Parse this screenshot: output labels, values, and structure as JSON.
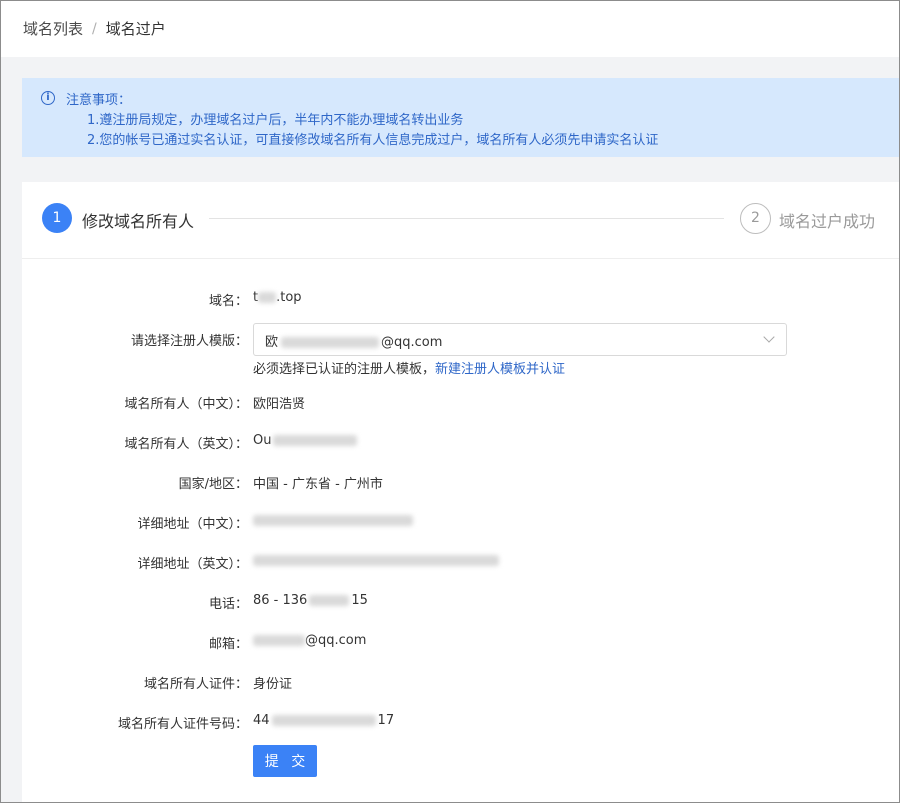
{
  "breadcrumb": {
    "item1": "域名列表",
    "separator": "/",
    "item2": "域名过户"
  },
  "notice": {
    "icon": "info-icon",
    "title": "注意事项：",
    "line1": "1.遵注册局规定，办理域名过户后，半年内不能办理域名转出业务",
    "line2": "2.您的帐号已通过实名认证，可直接修改域名所有人信息完成过户，域名所有人必须先申请实名认证"
  },
  "steps": [
    {
      "number": "1",
      "label": "修改域名所有人",
      "active": true
    },
    {
      "number": "2",
      "label": "域名过户成功",
      "active": false
    }
  ],
  "form": {
    "domain_label": "域名：",
    "domain_prefix": "t",
    "domain_suffix": ".top",
    "template_label": "请选择注册人模版：",
    "template_prefix": "欧",
    "template_suffix": "@qq.com",
    "hint_text": "必须选择已认证的注册人模板，",
    "hint_link": "新建注册人模板并认证",
    "owner_cn_label": "域名所有人（中文）：",
    "owner_cn_value": "欧阳浩贤",
    "owner_en_label": "域名所有人（英文）：",
    "owner_en_prefix": "Ou",
    "region_label": "国家/地区：",
    "region_value": "中国 - 广东省 - 广州市",
    "addr_cn_label": "详细地址（中文）：",
    "addr_en_label": "详细地址（英文）：",
    "phone_label": "电话：",
    "phone_prefix": "86 - 136",
    "phone_suffix": "15",
    "email_label": "邮箱：",
    "email_suffix": "@qq.com",
    "id_type_label": "域名所有人证件：",
    "id_type_value": "身份证",
    "id_number_label": "域名所有人证件号码：",
    "id_number_prefix": "44",
    "id_number_suffix": "17",
    "submit_label": "提 交"
  }
}
